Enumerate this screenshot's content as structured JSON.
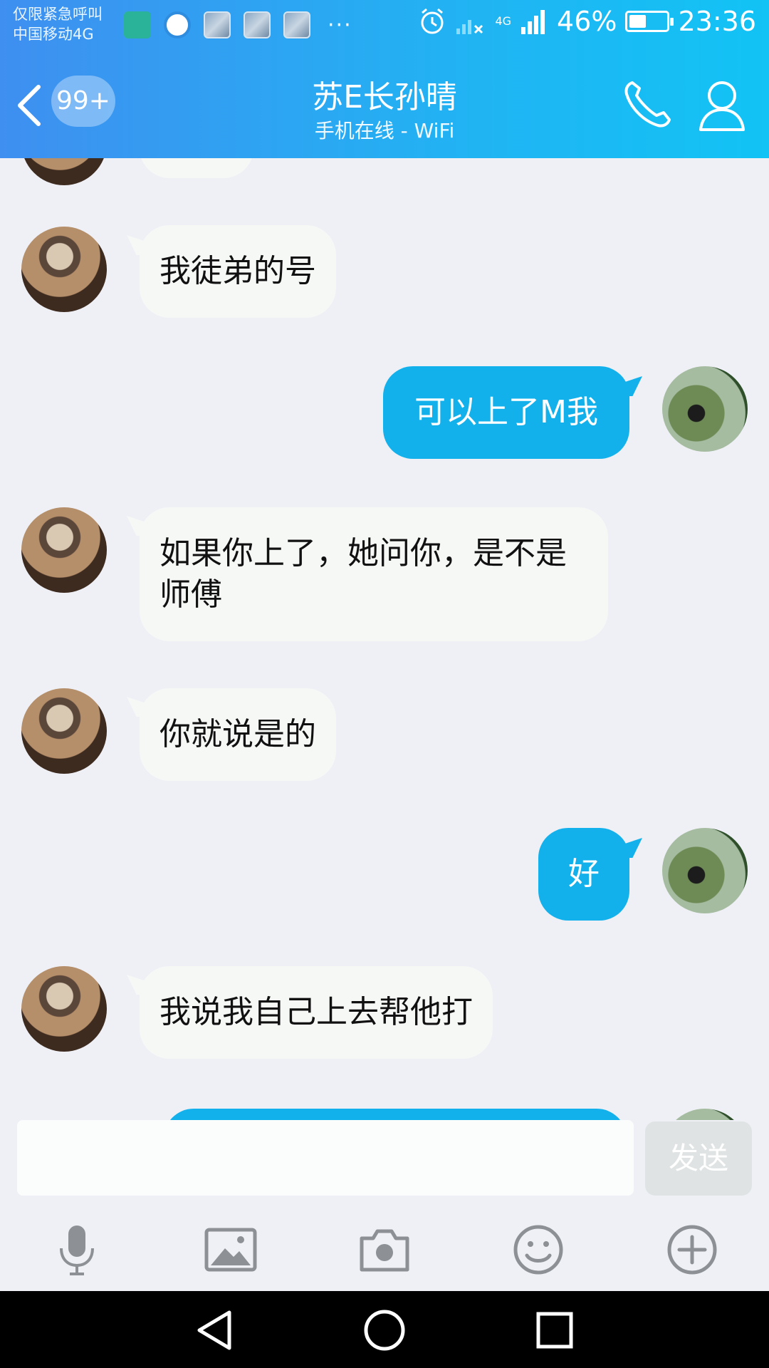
{
  "status_bar": {
    "carrier_line1": "仅限紧急呼叫",
    "carrier_line2": "中国移动4G",
    "more_indicator": "···",
    "network": "4G",
    "battery": "46%",
    "battery_level": 0.46,
    "time": "23:36"
  },
  "header": {
    "unread_badge": "99+",
    "contact_name": "苏E长孙晴",
    "presence": "手机在线 - WiFi"
  },
  "messages": [
    {
      "side": "in",
      "text": "我徒弟的号"
    },
    {
      "side": "out",
      "text": "可以上了M我"
    },
    {
      "side": "in",
      "text": "如果你上了，她问你，是不是师傅"
    },
    {
      "side": "in",
      "text": "你就说是的"
    },
    {
      "side": "out",
      "text": "好"
    },
    {
      "side": "in",
      "text": "我说我自己上去帮他打"
    }
  ],
  "composer": {
    "input_value": "",
    "send_label": "发送"
  },
  "toolbar": [
    "microphone-icon",
    "image-icon",
    "camera-icon",
    "emoji-icon",
    "plus-icon"
  ],
  "colors": {
    "header_start": "#3f8ff0",
    "header_end": "#12c3f5",
    "outgoing_bubble": "#13b1ec",
    "incoming_bubble": "#f6f8f6",
    "chat_background": "#eef0f6"
  }
}
